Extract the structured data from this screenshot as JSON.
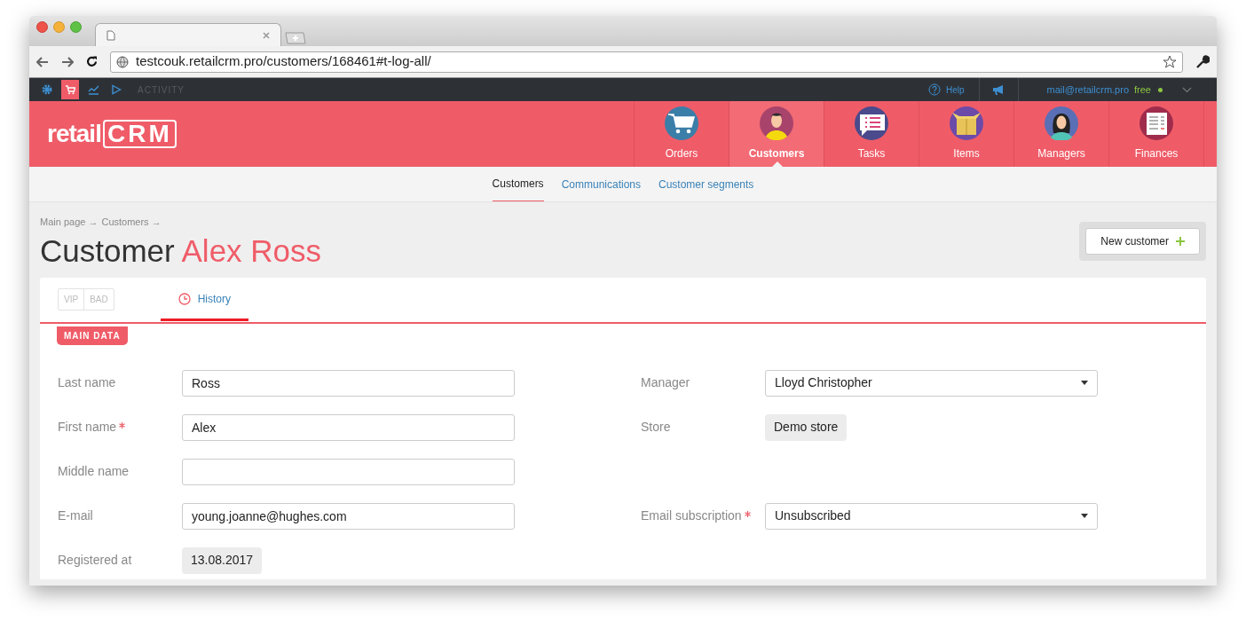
{
  "browser": {
    "url": "testcouk.retailcrm.pro/customers/168461#t-log-all/"
  },
  "toolbar": {
    "icons": [
      {
        "kind": "gear",
        "selected": false
      },
      {
        "kind": "cart",
        "selected": true
      },
      {
        "kind": "chart",
        "selected": false
      },
      {
        "kind": "play",
        "selected": false
      }
    ],
    "activity": "ACTIVITY",
    "help": "Help",
    "email": "mail@retailcrm.pro",
    "plan": "free"
  },
  "logo": {
    "text": "retail",
    "mark": "CRM"
  },
  "nav": [
    {
      "label": "Orders",
      "kind": "cart",
      "selected": false
    },
    {
      "label": "Customers",
      "kind": "man",
      "selected": true
    },
    {
      "label": "Tasks",
      "kind": "list",
      "selected": false
    },
    {
      "label": "Items",
      "kind": "box",
      "selected": false
    },
    {
      "label": "Managers",
      "kind": "woman",
      "selected": false
    },
    {
      "label": "Finances",
      "kind": "doc",
      "selected": false
    }
  ],
  "subnav": [
    {
      "label": "Customers",
      "selected": true
    },
    {
      "label": "Communications",
      "selected": false
    },
    {
      "label": "Customer segments",
      "selected": false
    }
  ],
  "breadcrumbs": [
    "Main page →",
    "Customers →"
  ],
  "title": {
    "prefix": "Customer",
    "name": "Alex Ross"
  },
  "new_button": "New customer",
  "tags": [
    "VIP",
    "BAD"
  ],
  "history_tab": "History",
  "section": "MAIN DATA",
  "rows": [
    {
      "left": {
        "label": "Last name",
        "required": false,
        "kind": "input",
        "value": "Ross"
      },
      "right": {
        "label": "Manager",
        "required": false,
        "kind": "select",
        "value": "Lloyd Christopher"
      }
    },
    {
      "left": {
        "label": "First name",
        "required": true,
        "kind": "input",
        "value": "Alex"
      },
      "right": {
        "label": "Store",
        "required": false,
        "kind": "tag",
        "value": "Demo store"
      }
    },
    {
      "left": {
        "label": "Middle name",
        "required": false,
        "kind": "input"
      }
    },
    {
      "left": {
        "label": "E-mail",
        "required": false,
        "kind": "input",
        "value": "young.joanne@hughes.com"
      },
      "right": {
        "label": "Email subscription",
        "required": true,
        "kind": "select",
        "value": "Unsubscribed"
      }
    },
    {
      "left": {
        "label": "Registered at",
        "required": false,
        "kind": "tag",
        "value": "13.08.2017"
      }
    }
  ]
}
